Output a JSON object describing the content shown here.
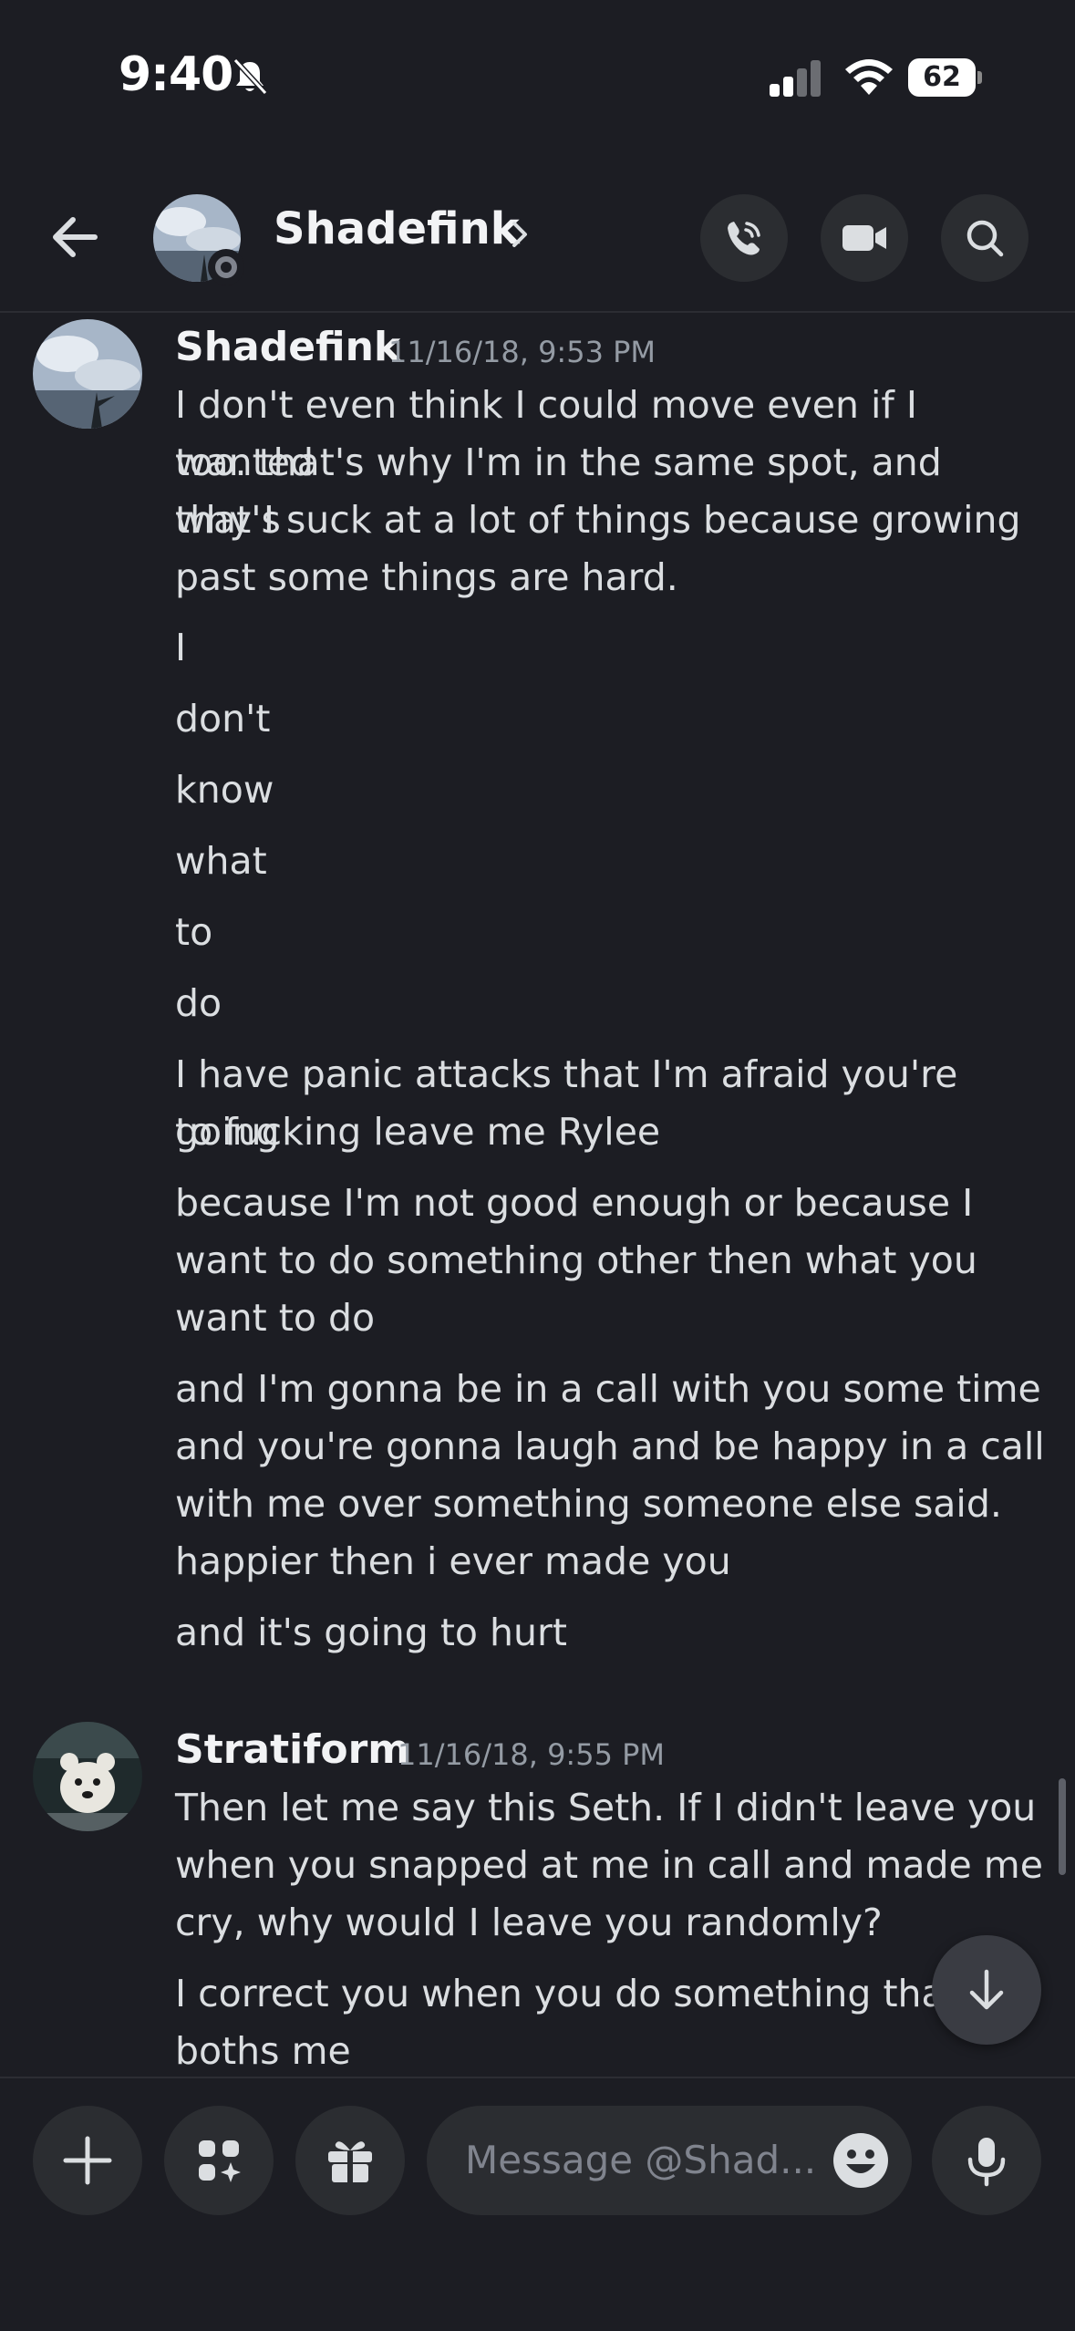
{
  "status_bar": {
    "time": "9:40",
    "battery": "62"
  },
  "header": {
    "name": "Shadefink"
  },
  "messages": [
    {
      "author": "Shadefink",
      "timestamp": "11/16/18, 9:53 PM",
      "lines": [
        "I don't even think I could move even if I wanted",
        "too. that's why I'm in the same spot, and that's",
        "why I suck at a lot of things because growing",
        "past some things are hard.",
        "I",
        "don't",
        "know",
        "what",
        "to",
        "do",
        "I have panic attacks that I'm afraid you're going",
        "to fucking leave me Rylee",
        "because I'm not good enough or because I",
        "want to do something other then what you",
        "want to do",
        "and I'm gonna be in a call with you some time",
        "and you're gonna laugh and be happy in a call",
        "with me over something someone else said.",
        "happier then i ever made you",
        "and it's going to hurt"
      ]
    },
    {
      "author": "Stratiform",
      "timestamp": "11/16/18, 9:55 PM",
      "lines": [
        "Then let me say this Seth. If I didn't leave you",
        "when you snapped at me in call and made me",
        "cry, why would I leave you randomly?",
        "I correct you when you do something that",
        "boths me"
      ]
    }
  ],
  "composer": {
    "placeholder": "Message @Shad..."
  },
  "colors": {
    "background": "#1c1d23",
    "button_bg": "#2b2d31",
    "text": "#dbdee1",
    "muted": "#949ba4"
  }
}
